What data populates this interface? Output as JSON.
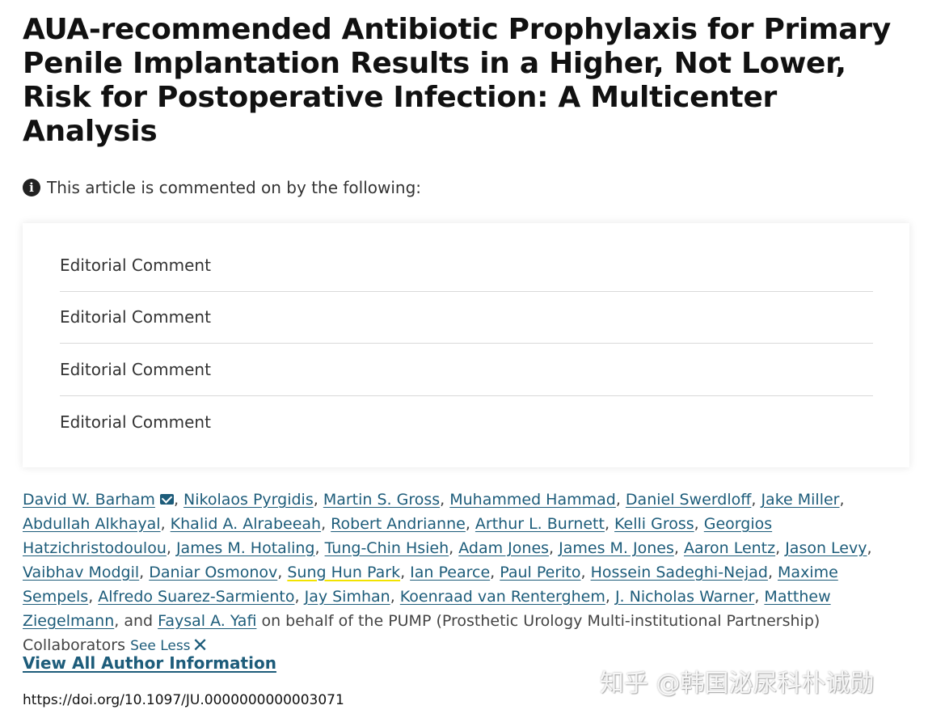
{
  "article": {
    "title": "AUA-recommended Antibiotic Prophylaxis for Primary Penile Implantation Results in a Higher, Not Lower, Risk for Postoperative Infection: A Multicenter Analysis",
    "comment_note": "This article is commented on by the following:",
    "comments": [
      "Editorial Comment",
      "Editorial Comment",
      "Editorial Comment",
      "Editorial Comment"
    ],
    "authors": [
      "David W. Barham",
      "Nikolaos Pyrgidis",
      "Martin S. Gross",
      "Muhammed Hammad",
      "Daniel Swerdloff",
      "Jake Miller",
      "Abdullah Alkhayal",
      "Khalid A. Alrabeeah",
      "Robert Andrianne",
      "Arthur L. Burnett",
      "Kelli Gross",
      "Georgios Hatzichristodoulou",
      "James M. Hotaling",
      "Tung-Chin Hsieh",
      "Adam Jones",
      "James M. Jones",
      "Aaron Lentz",
      "Jason Levy",
      "Vaibhav Modgil",
      "Daniar Osmonov",
      "Sung Hun Park",
      "Ian Pearce",
      "Paul Perito",
      "Hossein Sadeghi-Nejad",
      "Maxime Sempels",
      "Alfredo Suarez-Sarmiento",
      "Jay Simhan",
      "Koenraad van Renterghem",
      "J. Nicholas Warner",
      "Matthew Ziegelmann",
      "Faysal A. Yafi"
    ],
    "and_text": "and",
    "behalf_text": "on behalf of the PUMP (Prosthetic Urology Multi-institutional Partnership) Collaborators",
    "see_less": "See Less",
    "view_all": "View All Author Information",
    "doi": "https://doi.org/10.1097/JU.0000000000003071"
  },
  "watermark": "知乎 @韩国泌尿科朴诚勋",
  "colors": {
    "link": "#1d5c7a",
    "highlight": "#f2e300"
  },
  "icons": {
    "info": "info-circle-icon",
    "mail": "mail-icon",
    "close": "close-icon"
  }
}
